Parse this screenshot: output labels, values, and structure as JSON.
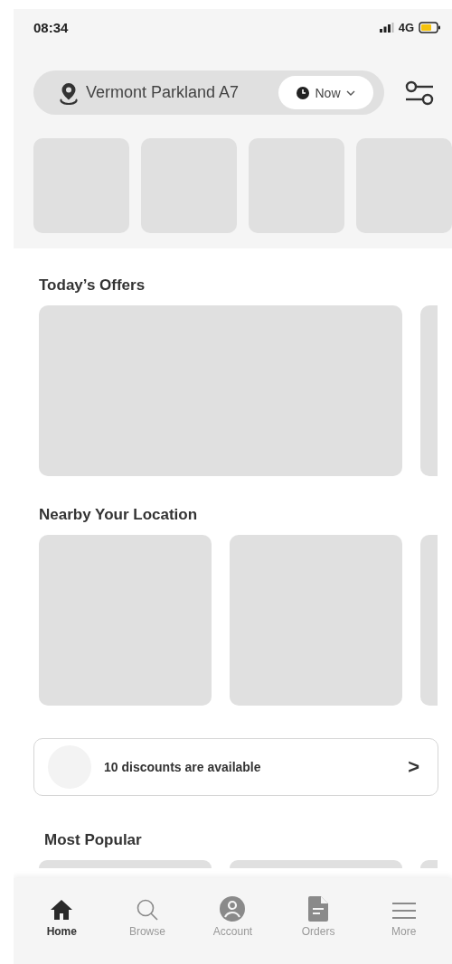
{
  "status_bar": {
    "time": "08:34",
    "network": "4G"
  },
  "location": {
    "address": "Vermont Parkland A7",
    "time_pill": "Now"
  },
  "sections": [
    {
      "title": "Today’s Offers"
    },
    {
      "title": "Nearby Your Location"
    }
  ],
  "discount_banner": {
    "text": "10 discounts are available",
    "arrow": ">"
  },
  "most_popular": {
    "title": "Most Popular"
  },
  "nav": [
    {
      "label": "Home",
      "selected": true
    },
    {
      "label": "Browse",
      "selected": false
    },
    {
      "label": "Account",
      "selected": false
    },
    {
      "label": "Orders",
      "selected": false
    },
    {
      "label": "More",
      "selected": false
    }
  ]
}
